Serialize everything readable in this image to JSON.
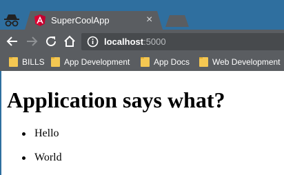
{
  "browser": {
    "tab": {
      "title": "SuperCoolApp",
      "favicon": "angular-icon",
      "close_glyph": "×"
    },
    "omnibox": {
      "host": "localhost",
      "port": ":5000"
    },
    "bookmarks": [
      {
        "label": "BILLS",
        "icon": "folder-icon"
      },
      {
        "label": "App Development",
        "icon": "folder-icon"
      },
      {
        "label": "App Docs",
        "icon": "folder-icon"
      },
      {
        "label": "Web Development",
        "icon": "folder-icon"
      }
    ],
    "colors": {
      "frame": "#2f6f9f",
      "toolbar": "#5a5d61",
      "omnibox": "#474a4d",
      "folder": "#f4c752",
      "angular": "#dd0031"
    }
  },
  "page": {
    "heading": "Application says what?",
    "items": [
      "Hello",
      "World"
    ]
  }
}
